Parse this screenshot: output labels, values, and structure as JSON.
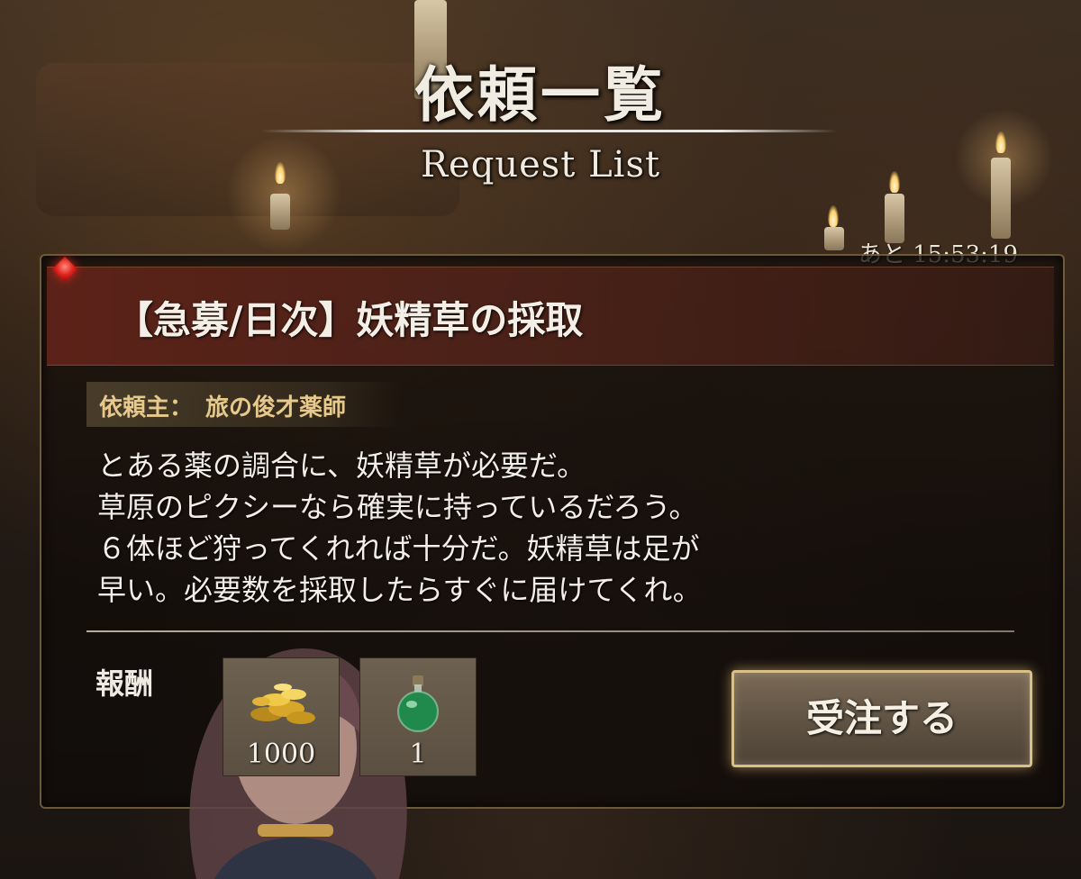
{
  "header": {
    "title": "依頼一覧",
    "subtitle": "Request List"
  },
  "timer": {
    "prefix": "あと",
    "time": "15:53:19"
  },
  "quest": {
    "title": "【急募/日次】妖精草の採取",
    "client_label": "依頼主：",
    "client_name": "旅の俊才薬師",
    "description": [
      "とある薬の調合に、妖精草が必要だ。",
      "草原のピクシーなら確実に持っているだろう。",
      "６体ほど狩ってくれれば十分だ。妖精草は足が",
      "早い。必要数を採取したらすぐに届けてくれ。"
    ]
  },
  "rewards": {
    "label": "報酬",
    "items": [
      {
        "icon": "gold-coins-icon",
        "count": "1000"
      },
      {
        "icon": "green-potion-icon",
        "count": "1"
      }
    ]
  },
  "actions": {
    "accept_label": "受注する"
  },
  "colors": {
    "header_band": "#5f2319",
    "client_text": "#e6c98b",
    "accent_gold": "#d8c08a",
    "alert_red": "#e0211c"
  }
}
